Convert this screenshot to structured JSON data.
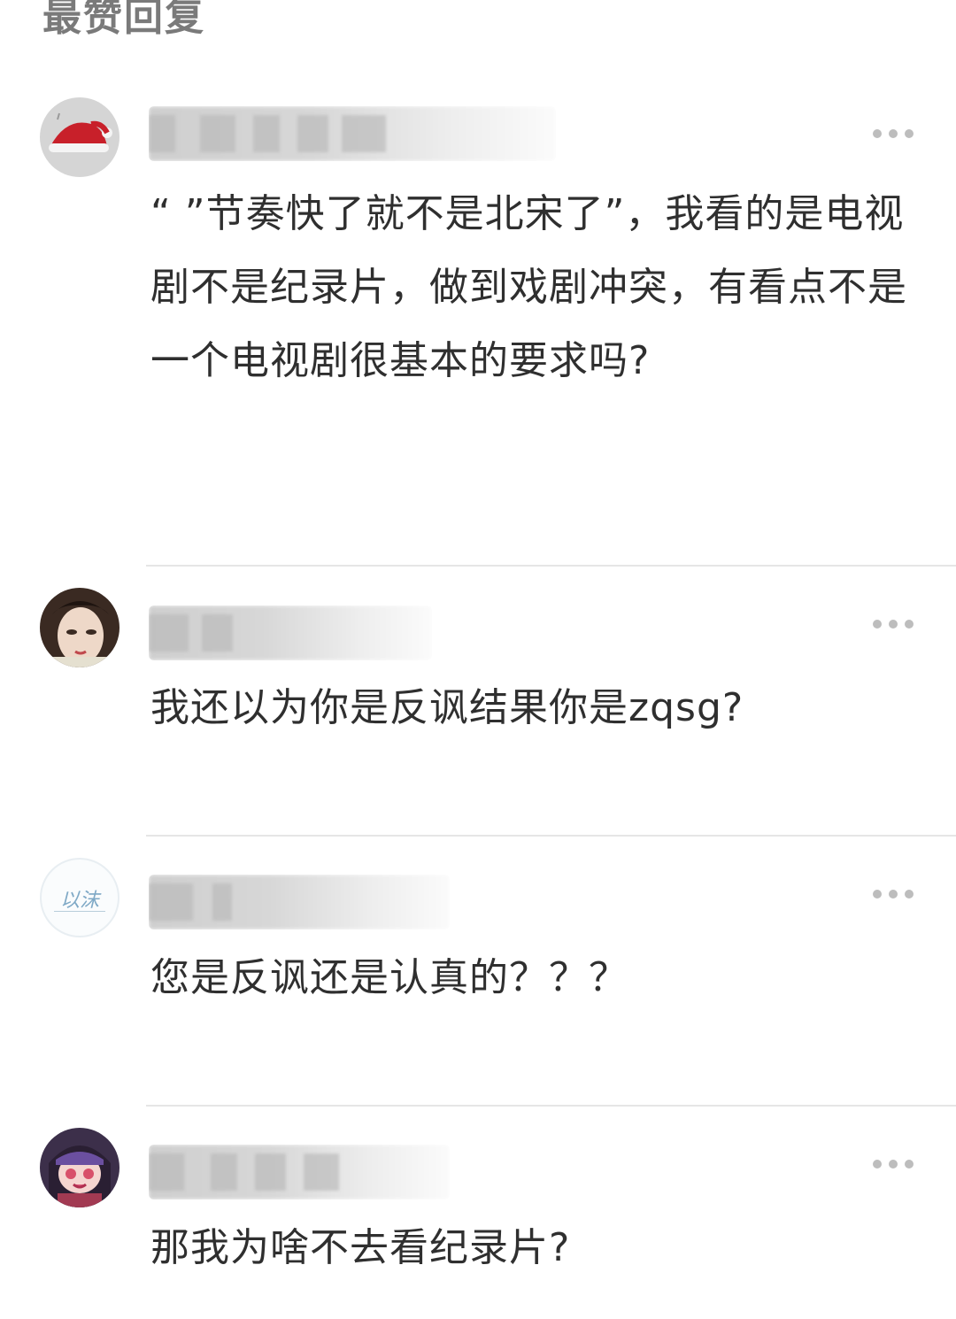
{
  "section": {
    "title": "最赞回复"
  },
  "comments": [
    {
      "avatar_icon": "santa-hat-avatar",
      "text": "“ ”节奏快了就不是北宋了”，我看的是电视剧不是纪录片，做到戏剧冲突，有看点不是一个电视剧很基本的要求吗?",
      "more_icon": "more-dots-icon"
    },
    {
      "avatar_icon": "opera-face-avatar",
      "text": "我还以为你是反讽结果你是zqsg?",
      "more_icon": "more-dots-icon"
    },
    {
      "avatar_icon": "calligraphy-avatar",
      "avatar_text": "以沫",
      "text": "您是反讽还是认真的？？？",
      "more_icon": "more-dots-icon"
    },
    {
      "avatar_icon": "anime-girl-avatar",
      "text": "那我为啥不去看纪录片?",
      "more_icon": "more-dots-icon"
    }
  ],
  "colors": {
    "title": "#7a7a7a",
    "text": "#2f2f2f",
    "divider": "#e6e6e6",
    "dots": "#bdbdbd"
  }
}
